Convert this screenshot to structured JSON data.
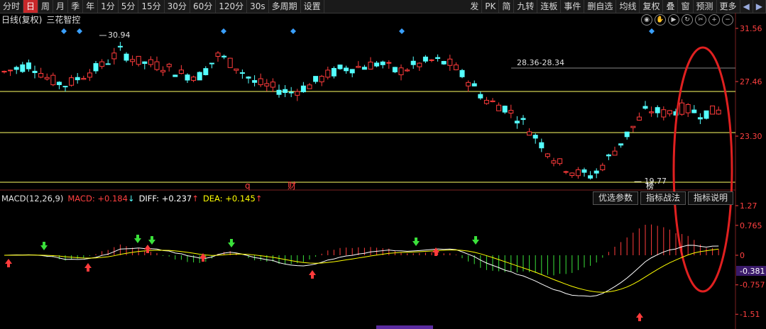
{
  "toolbar": {
    "left_items": [
      "分时",
      "日",
      "周",
      "月",
      "季",
      "年",
      "1分",
      "5分",
      "15分",
      "30分",
      "60分",
      "120分",
      "30s",
      "多周期",
      "设置"
    ],
    "active": "日",
    "right_items": [
      "发",
      "PK",
      "简",
      "九转",
      "连板",
      "事件",
      "删自选",
      "均线",
      "复权",
      "叠",
      "窗",
      "预测",
      "更多"
    ]
  },
  "stock": {
    "period": "日线(复权)",
    "name": "三花智控"
  },
  "price_axis": {
    "labels": [
      "31.56",
      "27.46",
      "23.30"
    ],
    "max_label": "30.94",
    "min_label": "19.77",
    "range_label": "28.36-28.34"
  },
  "markers": {
    "q": "q",
    "cai": "财",
    "bang": "榜"
  },
  "macd": {
    "title": "MACD(12,26,9)",
    "macd_label": "MACD:",
    "macd_value": "+0.184",
    "macd_arrow": "↓",
    "diff_label": "DIFF:",
    "diff_value": "+0.237",
    "diff_arrow": "↑",
    "dea_label": "DEA:",
    "dea_value": "+0.145",
    "dea_arrow": "↑",
    "axis_labels": [
      "1.27",
      "0.765",
      "0",
      "-0.757",
      "-1.51"
    ],
    "current_label": "-0.381"
  },
  "panel_buttons": [
    "优选参数",
    "指标战法",
    "指标说明"
  ],
  "colors": {
    "up": "#ff3b3b",
    "down": "#54ffff",
    "diff": "#ffffff",
    "dea": "#ffff00",
    "accent_red": "#e02020"
  }
}
